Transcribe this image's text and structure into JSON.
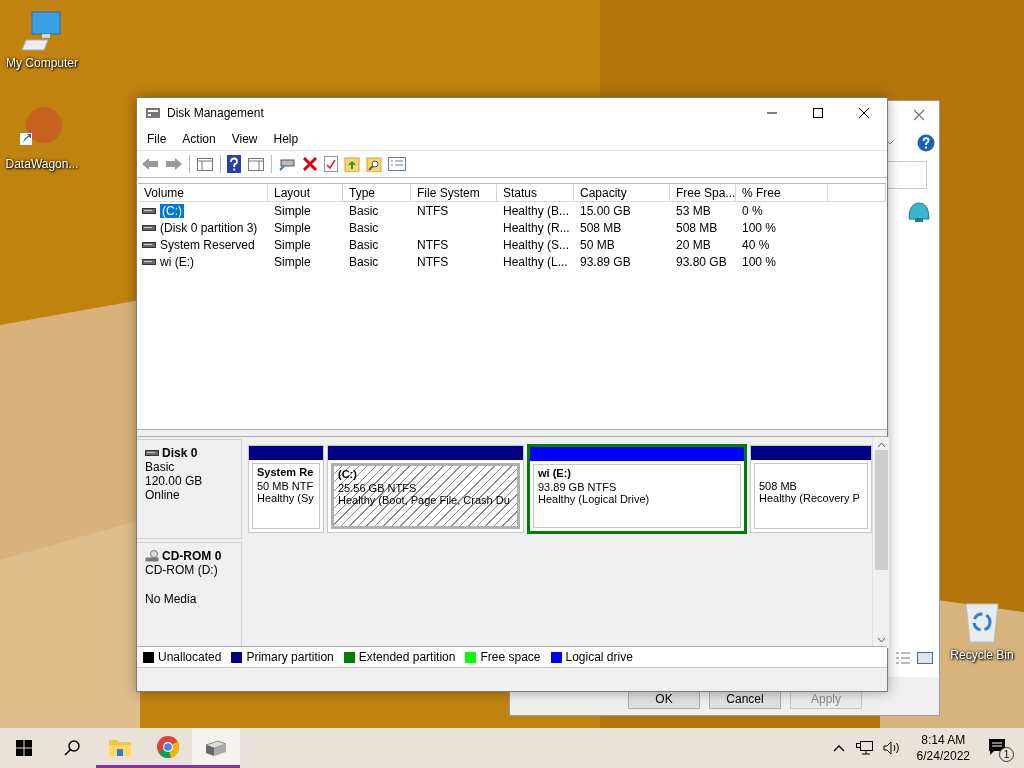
{
  "desktop_icons": [
    {
      "label": "My Computer",
      "kind": "computer"
    },
    {
      "label": "DataWagon...",
      "kind": "shortcut"
    },
    {
      "label": "Recycle Bin",
      "kind": "recycle"
    }
  ],
  "back_window": {
    "buttons": [
      {
        "label": "OK",
        "disabled": false
      },
      {
        "label": "Cancel",
        "disabled": false
      },
      {
        "label": "Apply",
        "disabled": true
      }
    ]
  },
  "window": {
    "title": "Disk Management"
  },
  "menu": [
    "File",
    "Action",
    "View",
    "Help"
  ],
  "table": {
    "columns": [
      "Volume",
      "Layout",
      "Type",
      "File System",
      "Status",
      "Capacity",
      "Free Spa...",
      "% Free"
    ],
    "rows": [
      {
        "selected": true,
        "cells": [
          "(C:)",
          "Simple",
          "Basic",
          "NTFS",
          "Healthy (B...",
          "15.00 GB",
          "53 MB",
          "0 %"
        ]
      },
      {
        "selected": false,
        "cells": [
          "(Disk 0 partition 3)",
          "Simple",
          "Basic",
          "",
          "Healthy (R...",
          "508 MB",
          "508 MB",
          "100 %"
        ]
      },
      {
        "selected": false,
        "cells": [
          "System Reserved",
          "Simple",
          "Basic",
          "NTFS",
          "Healthy (S...",
          "50 MB",
          "20 MB",
          "40 %"
        ]
      },
      {
        "selected": false,
        "cells": [
          "wi (E:)",
          "Simple",
          "Basic",
          "NTFS",
          "Healthy (L...",
          "93.89 GB",
          "93.80 GB",
          "100 %"
        ]
      }
    ]
  },
  "disks": [
    {
      "kind": "disk",
      "name": "Disk 0",
      "lines": [
        "Basic",
        "120.00 GB",
        "Online"
      ],
      "partitions": [
        {
          "kind": "primary",
          "name": "System Re",
          "size": "50 MB NTF",
          "status": "Healthy (Sy",
          "selected": false,
          "extended": false
        },
        {
          "kind": "primary",
          "name": "(C:)",
          "size": "25.56 GB NTFS",
          "status": "Healthy (Boot, Page File, Crash Du",
          "selected": true,
          "extended": false
        },
        {
          "kind": "logical",
          "name": "wi  (E:)",
          "size": "93.89 GB NTFS",
          "status": "Healthy (Logical Drive)",
          "selected": false,
          "extended": true
        },
        {
          "kind": "primary",
          "size": "508 MB",
          "status": "Healthy (Recovery P",
          "selected": false,
          "extended": false
        }
      ]
    },
    {
      "kind": "cdrom",
      "name": "CD-ROM 0",
      "lines": [
        "CD-ROM (D:)"
      ],
      "media": "No Media"
    }
  ],
  "legend": [
    {
      "label": "Unallocated",
      "color": "#000000"
    },
    {
      "label": "Primary partition",
      "color": "#000080"
    },
    {
      "label": "Extended partition",
      "color": "#008000"
    },
    {
      "label": "Free space",
      "color": "#00ff00"
    },
    {
      "label": "Logical drive",
      "color": "#0000ff"
    }
  ],
  "taskbar": {
    "apps": [
      {
        "kind": "explorer",
        "active": false
      },
      {
        "kind": "chrome",
        "active": false
      },
      {
        "kind": "diskmgmt",
        "active": true
      }
    ],
    "time": "8:14 AM",
    "date": "6/24/2022",
    "notifications": "1"
  }
}
